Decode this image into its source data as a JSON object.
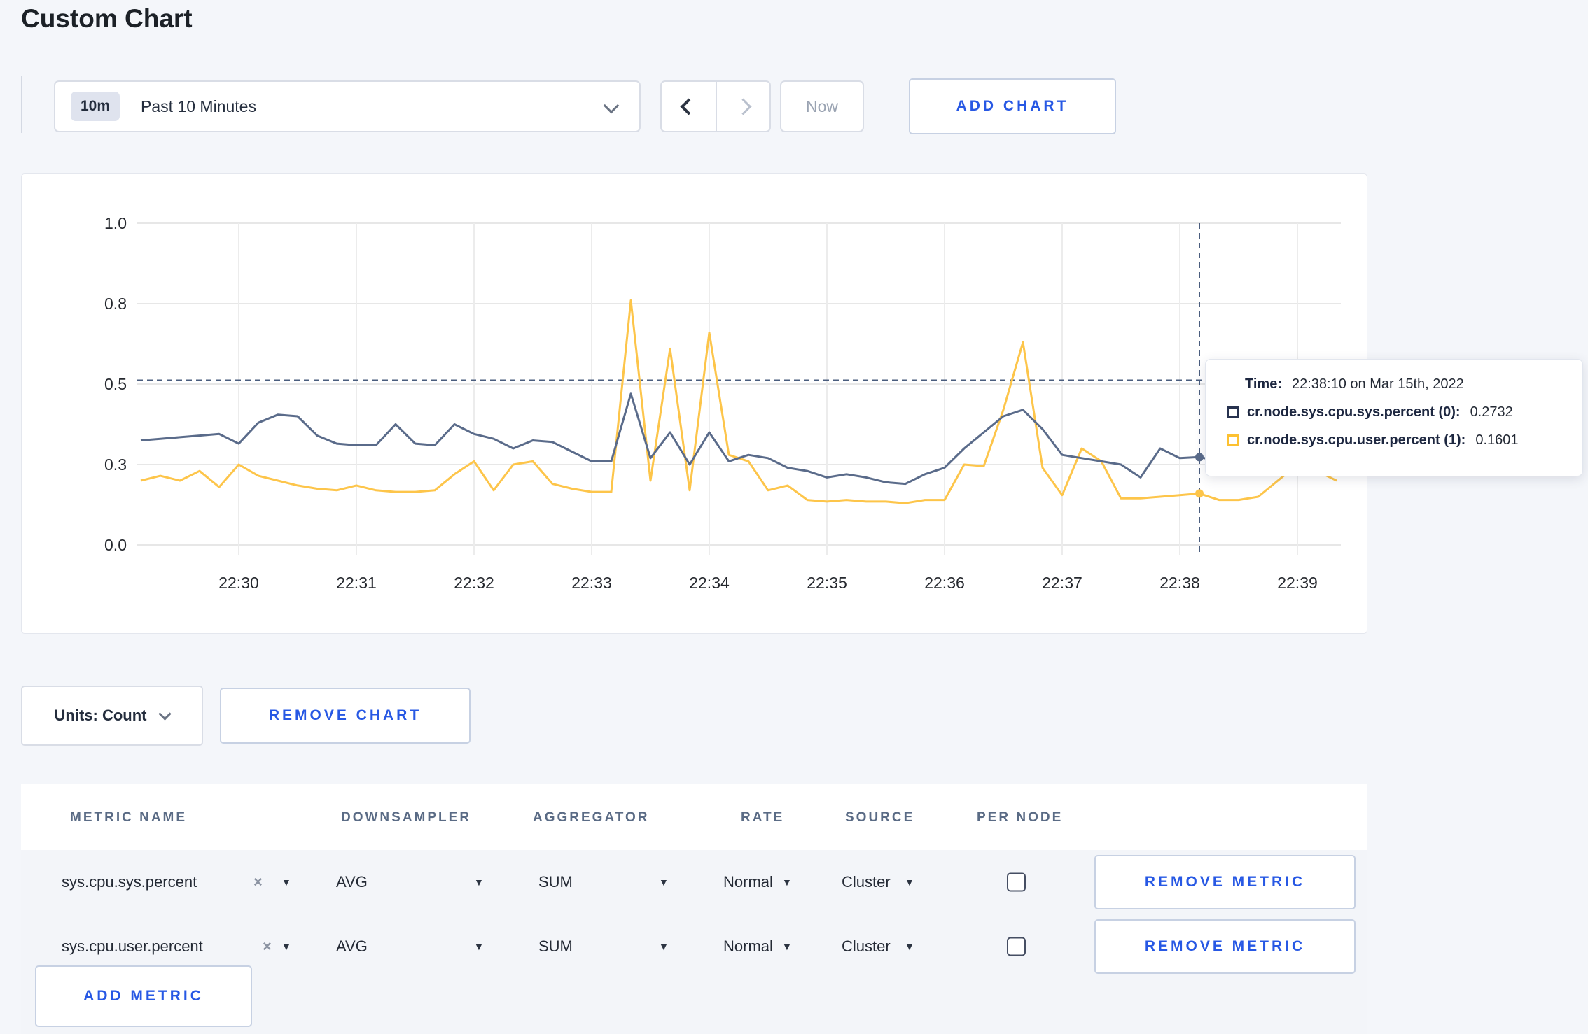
{
  "page_title": "Custom Chart",
  "colors": {
    "accent_blue": "#2758e4",
    "page_background": "#f4f6fa",
    "series_sys": "#5a6b8a",
    "series_user": "#fdc54a",
    "crosshair": "#4a5d7e",
    "gridline": "#e7e7e7",
    "tooltip_swatch_sys": "#27324f",
    "tooltip_swatch_user": "#fdc131"
  },
  "toolbar": {
    "range_badge": "10m",
    "range_label": "Past 10 Minutes",
    "now_label": "Now",
    "add_chart_label": "ADD CHART"
  },
  "chart_data": {
    "type": "line",
    "title": "",
    "xlabel": "",
    "ylabel": "",
    "ylim": [
      0,
      1
    ],
    "grid": true,
    "legend_position": "hidden",
    "x_start": "22:29:10",
    "x_interval_seconds": 10,
    "x_tick_labels": [
      "22:30",
      "22:31",
      "22:32",
      "22:33",
      "22:34",
      "22:35",
      "22:36",
      "22:37",
      "22:38",
      "22:39"
    ],
    "y_tick_labels": [
      "0.0",
      "0.3",
      "0.5",
      "0.8",
      "1.0"
    ],
    "y_tick_values": [
      0,
      0.25,
      0.5,
      0.75,
      1.0
    ],
    "series": [
      {
        "name": "cr.node.sys.cpu.sys.percent",
        "color": "#5a6b8a",
        "values": [
          0.325,
          0.33,
          0.335,
          0.34,
          0.345,
          0.315,
          0.38,
          0.405,
          0.4,
          0.34,
          0.315,
          0.31,
          0.31,
          0.375,
          0.315,
          0.31,
          0.375,
          0.345,
          0.33,
          0.3,
          0.325,
          0.32,
          0.29,
          0.26,
          0.26,
          0.47,
          0.27,
          0.35,
          0.25,
          0.35,
          0.26,
          0.28,
          0.27,
          0.24,
          0.23,
          0.21,
          0.22,
          0.21,
          0.195,
          0.19,
          0.22,
          0.24,
          0.3,
          0.35,
          0.4,
          0.42,
          0.36,
          0.28,
          0.27,
          0.26,
          0.25,
          0.21,
          0.3,
          0.27,
          0.2732,
          0.26,
          0.3,
          0.31,
          0.3,
          0.305,
          0.3,
          0.295
        ]
      },
      {
        "name": "cr.node.sys.cpu.user.percent",
        "color": "#fdc54a",
        "values": [
          0.2,
          0.215,
          0.2,
          0.23,
          0.18,
          0.25,
          0.215,
          0.2,
          0.185,
          0.175,
          0.17,
          0.185,
          0.17,
          0.165,
          0.165,
          0.17,
          0.22,
          0.26,
          0.17,
          0.25,
          0.26,
          0.19,
          0.175,
          0.165,
          0.165,
          0.76,
          0.2,
          0.61,
          0.17,
          0.66,
          0.28,
          0.26,
          0.17,
          0.185,
          0.14,
          0.135,
          0.14,
          0.135,
          0.135,
          0.13,
          0.14,
          0.14,
          0.25,
          0.245,
          0.42,
          0.63,
          0.24,
          0.155,
          0.3,
          0.26,
          0.145,
          0.145,
          0.15,
          0.155,
          0.1601,
          0.14,
          0.14,
          0.15,
          0.2,
          0.25,
          0.23,
          0.2
        ]
      }
    ],
    "hover": {
      "index": 54,
      "time": "22:38:10",
      "crosshair_y_value": 0.512
    }
  },
  "tooltip": {
    "time_label": "Time:",
    "time_value": "22:38:10 on Mar 15th, 2022",
    "entries": [
      {
        "label": "cr.node.sys.cpu.sys.percent (0):",
        "value": "0.2732",
        "swatch_color": "#27324f"
      },
      {
        "label": "cr.node.sys.cpu.user.percent (1):",
        "value": "0.1601",
        "swatch_color": "#fdc131"
      }
    ]
  },
  "units_bar": {
    "units_label": "Units: Count",
    "remove_chart_label": "REMOVE CHART"
  },
  "metrics": {
    "headers": [
      "METRIC NAME",
      "DOWNSAMPLER",
      "AGGREGATOR",
      "RATE",
      "SOURCE",
      "PER NODE"
    ],
    "rows": [
      {
        "name": "sys.cpu.sys.percent",
        "remove_x": "×",
        "downsampler": "AVG",
        "aggregator": "SUM",
        "rate": "Normal",
        "source": "Cluster",
        "per_node_checked": false,
        "remove_label": "REMOVE METRIC"
      },
      {
        "name": "sys.cpu.user.percent",
        "remove_x": "×",
        "downsampler": "AVG",
        "aggregator": "SUM",
        "rate": "Normal",
        "source": "Cluster",
        "per_node_checked": false,
        "remove_label": "REMOVE METRIC"
      }
    ],
    "add_metric_label": "ADD METRIC"
  }
}
